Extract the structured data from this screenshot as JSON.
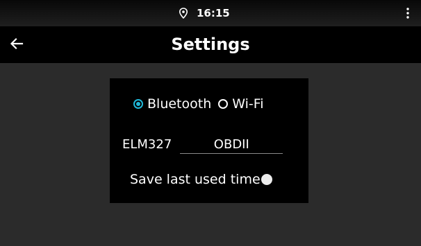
{
  "status_bar": {
    "time": "16:15",
    "location_icon": "location-pin-icon",
    "overflow_icon": "more-vert-icon"
  },
  "app_bar": {
    "title": "Settings",
    "back_icon": "arrow-back-icon"
  },
  "settings": {
    "connection": {
      "options": [
        {
          "label": "Bluetooth",
          "selected": true
        },
        {
          "label": "Wi-Fi",
          "selected": false
        }
      ]
    },
    "adapter": {
      "label": "ELM327",
      "value": "OBDII"
    },
    "save_last_used_time": {
      "label": "Save last used time",
      "enabled": false
    }
  },
  "colors": {
    "accent": "#20b8d8",
    "panel_background": "#000000",
    "page_background": "#2b2b2b"
  }
}
